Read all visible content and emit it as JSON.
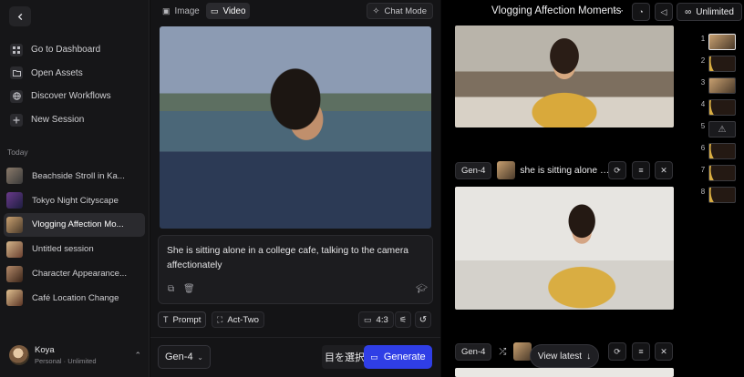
{
  "sidebar": {
    "nav": [
      {
        "label": "Go to Dashboard",
        "icon": "grid-icon"
      },
      {
        "label": "Open Assets",
        "icon": "folder-icon"
      },
      {
        "label": "Discover Workflows",
        "icon": "globe-icon"
      },
      {
        "label": "New Session",
        "icon": "plus-icon"
      }
    ],
    "section_label": "Today",
    "sessions": [
      {
        "label": "Beachside Stroll in Ka..."
      },
      {
        "label": "Tokyo Night Cityscape"
      },
      {
        "label": "Vlogging Affection Mo...",
        "active": true
      },
      {
        "label": "Untitled session"
      },
      {
        "label": "Character Appearance..."
      },
      {
        "label": "Café Location Change"
      }
    ],
    "user": {
      "name": "Koya",
      "plan": "Personal · Unlimited"
    }
  },
  "center": {
    "tabs": [
      {
        "label": "Image"
      },
      {
        "label": "Video",
        "active": true
      }
    ],
    "chat_mode_label": "Chat Mode",
    "prompt_text": "She is sitting alone in a college cafe, talking to the camera affectionately",
    "prompt_mode_label": "Prompt",
    "act_two_label": "Act-Two",
    "aspect_ratio": "4:3",
    "model": "Gen-4",
    "select_label": "目を選択",
    "generate_label": "Generate"
  },
  "right": {
    "title": "Vlogging Affection Moments",
    "unlimited_label": "Unlimited",
    "generations": [
      {
        "model": "Gen-4",
        "prompt": "she is sitting alone in a college cafe"
      },
      {
        "model": "Gen-4"
      }
    ],
    "view_latest_label": "View latest",
    "indices": [
      "1",
      "2",
      "3",
      "4",
      "5",
      "6",
      "7",
      "8"
    ]
  }
}
